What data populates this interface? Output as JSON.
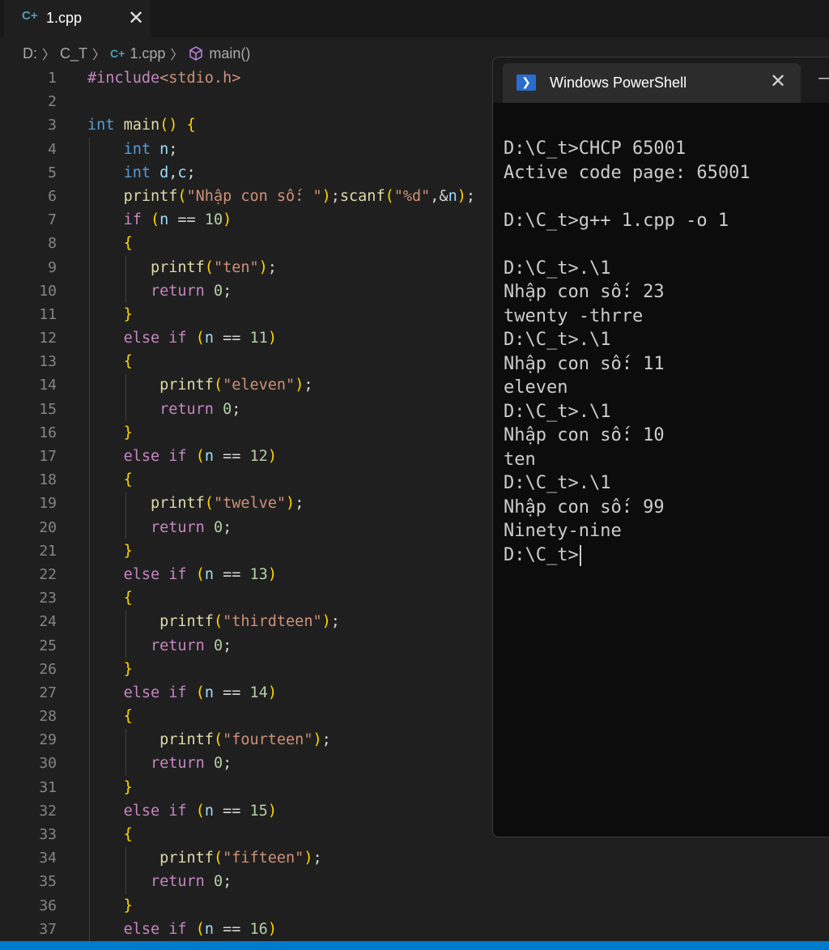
{
  "tab": {
    "label": "1.cpp",
    "icon": "cpp-file-icon"
  },
  "breadcrumb": {
    "drive": "D:",
    "folder": "C_T",
    "file": "1.cpp",
    "symbol": "main()"
  },
  "line_numbers": [
    "1",
    "2",
    "3",
    "4",
    "5",
    "6",
    "7",
    "8",
    "9",
    "10",
    "11",
    "12",
    "13",
    "14",
    "15",
    "16",
    "17",
    "18",
    "19",
    "20",
    "21",
    "22",
    "23",
    "24",
    "25",
    "26",
    "27",
    "28",
    "29",
    "30",
    "31",
    "32",
    "33",
    "34",
    "35",
    "36",
    "37"
  ],
  "code_lines": [
    "#include<stdio.h>",
    "",
    "int main() {",
    "    int n;",
    "    int d,c;",
    "    printf(\"Nhập con số: \");scanf(\"%d\",&n);",
    "    if (n == 10)",
    "    {",
    "       printf(\"ten\");",
    "       return 0;",
    "    }",
    "    else if (n == 11)",
    "    {",
    "        printf(\"eleven\");",
    "        return 0;",
    "    }",
    "    else if (n == 12)",
    "    {",
    "       printf(\"twelve\");",
    "       return 0;",
    "    }",
    "    else if (n == 13)",
    "    {",
    "        printf(\"thirdteen\");",
    "       return 0;",
    "    }",
    "    else if (n == 14)",
    "    {",
    "        printf(\"fourteen\");",
    "       return 0;",
    "    }",
    "    else if (n == 15)",
    "    {",
    "        printf(\"fifteen\");",
    "       return 0;",
    "    }",
    "    else if (n == 16)"
  ],
  "terminal": {
    "title": "Windows PowerShell",
    "lines": [
      "D:\\C_t>CHCP 65001",
      "Active code page: 65001",
      "",
      "D:\\C_t>g++ 1.cpp -o 1",
      "",
      "D:\\C_t>.\\1",
      "Nhập con số: 23",
      "twenty -thrre",
      "D:\\C_t>.\\1",
      "Nhập con số: 11",
      "eleven",
      "D:\\C_t>.\\1",
      "Nhập con số: 10",
      "ten",
      "D:\\C_t>.\\1",
      "Nhập con số: 99",
      "Ninety-nine",
      "D:\\C_t>"
    ]
  },
  "colors": {
    "editor_bg": "#1f1f1f",
    "terminal_bg": "#0c0c0c",
    "statusbar": "#007acc",
    "keyword": "#569cd6",
    "control": "#c586c0",
    "function": "#dcdcaa",
    "string": "#ce9178",
    "number": "#b5cea8",
    "variable": "#9cdcfe"
  }
}
